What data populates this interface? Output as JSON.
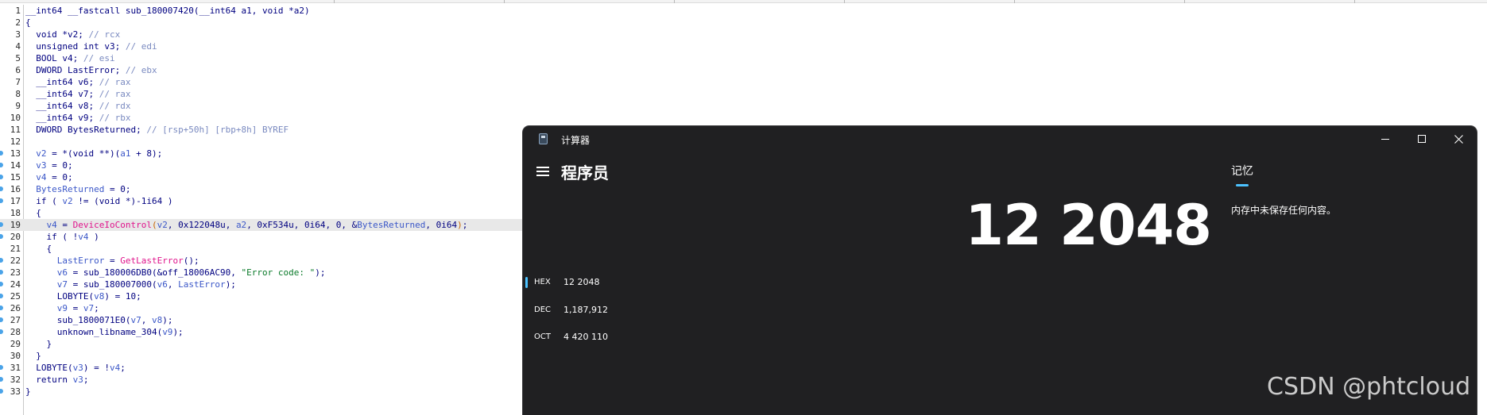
{
  "editor": {
    "lines": [
      {
        "n": "1",
        "code": [
          [
            "n",
            "__int64 __fastcall sub_180007420(__int64 a1, void *a2)"
          ]
        ]
      },
      {
        "n": "2",
        "code": [
          [
            "p",
            "{"
          ]
        ]
      },
      {
        "n": "3",
        "code": [
          [
            "n",
            "  void *v2; "
          ],
          [
            "c",
            "// rcx"
          ]
        ]
      },
      {
        "n": "4",
        "code": [
          [
            "n",
            "  unsigned int v3; "
          ],
          [
            "c",
            "// edi"
          ]
        ]
      },
      {
        "n": "5",
        "code": [
          [
            "n",
            "  BOOL v4; "
          ],
          [
            "c",
            "// esi"
          ]
        ]
      },
      {
        "n": "6",
        "code": [
          [
            "n",
            "  DWORD LastError; "
          ],
          [
            "c",
            "// ebx"
          ]
        ]
      },
      {
        "n": "7",
        "code": [
          [
            "n",
            "  __int64 v6; "
          ],
          [
            "c",
            "// rax"
          ]
        ]
      },
      {
        "n": "8",
        "code": [
          [
            "n",
            "  __int64 v7; "
          ],
          [
            "c",
            "// rax"
          ]
        ]
      },
      {
        "n": "9",
        "code": [
          [
            "n",
            "  __int64 v8; "
          ],
          [
            "c",
            "// rdx"
          ]
        ]
      },
      {
        "n": "10",
        "code": [
          [
            "n",
            "  __int64 v9; "
          ],
          [
            "c",
            "// rbx"
          ]
        ]
      },
      {
        "n": "11",
        "code": [
          [
            "n",
            "  DWORD BytesReturned; "
          ],
          [
            "c",
            "// [rsp+50h] [rbp+8h] BYREF"
          ]
        ]
      },
      {
        "n": "12",
        "code": []
      },
      {
        "n": "13",
        "bp": true,
        "code": [
          [
            "v",
            "  v2"
          ],
          [
            "n",
            " = *(void **)("
          ],
          [
            "v",
            "a1"
          ],
          [
            "n",
            " + 8);"
          ]
        ]
      },
      {
        "n": "14",
        "bp": true,
        "code": [
          [
            "v",
            "  v3"
          ],
          [
            "n",
            " = 0;"
          ]
        ]
      },
      {
        "n": "15",
        "bp": true,
        "code": [
          [
            "v",
            "  v4"
          ],
          [
            "n",
            " = 0;"
          ]
        ]
      },
      {
        "n": "16",
        "bp": true,
        "code": [
          [
            "v",
            "  BytesReturned"
          ],
          [
            "n",
            " = 0;"
          ]
        ]
      },
      {
        "n": "17",
        "bp": true,
        "code": [
          [
            "k",
            "  if"
          ],
          [
            "n",
            " ( "
          ],
          [
            "v",
            "v2"
          ],
          [
            "n",
            " != (void *)-1i64 )"
          ]
        ]
      },
      {
        "n": "18",
        "code": [
          [
            "p",
            "  {"
          ]
        ]
      },
      {
        "n": "19",
        "bp": true,
        "hl": true,
        "code": [
          [
            "v",
            "    v4"
          ],
          [
            "n",
            " = "
          ],
          [
            "f",
            "DeviceIoControl"
          ],
          [
            "o",
            "("
          ],
          [
            "v",
            "v2"
          ],
          [
            "n",
            ", 0x122048u, "
          ],
          [
            "v",
            "a2"
          ],
          [
            "n",
            ", 0xF534u, 0i64, 0, &"
          ],
          [
            "v",
            "BytesReturned"
          ],
          [
            "n",
            ", 0i64"
          ],
          [
            "o",
            ")"
          ],
          [
            "n",
            ";"
          ]
        ]
      },
      {
        "n": "20",
        "bp": true,
        "code": [
          [
            "k",
            "    if"
          ],
          [
            "n",
            " ( !"
          ],
          [
            "v",
            "v4"
          ],
          [
            "n",
            " )"
          ]
        ]
      },
      {
        "n": "21",
        "code": [
          [
            "p",
            "    {"
          ]
        ]
      },
      {
        "n": "22",
        "bp": true,
        "code": [
          [
            "v",
            "      LastError"
          ],
          [
            "n",
            " = "
          ],
          [
            "f",
            "GetLastError"
          ],
          [
            "n",
            "();"
          ]
        ]
      },
      {
        "n": "23",
        "bp": true,
        "code": [
          [
            "v",
            "      v6"
          ],
          [
            "n",
            " = sub_180006DB0(&off_18006AC90, "
          ],
          [
            "s",
            "\"Error code: \""
          ],
          [
            "n",
            ");"
          ]
        ]
      },
      {
        "n": "24",
        "bp": true,
        "code": [
          [
            "v",
            "      v7"
          ],
          [
            "n",
            " = sub_180007000("
          ],
          [
            "v",
            "v6"
          ],
          [
            "n",
            ", "
          ],
          [
            "v",
            "LastError"
          ],
          [
            "n",
            ");"
          ]
        ]
      },
      {
        "n": "25",
        "bp": true,
        "code": [
          [
            "n",
            "      LOBYTE("
          ],
          [
            "v",
            "v8"
          ],
          [
            "n",
            ") = 10;"
          ]
        ]
      },
      {
        "n": "26",
        "bp": true,
        "code": [
          [
            "v",
            "      v9"
          ],
          [
            "n",
            " = "
          ],
          [
            "v",
            "v7"
          ],
          [
            "n",
            ";"
          ]
        ]
      },
      {
        "n": "27",
        "bp": true,
        "code": [
          [
            "n",
            "      sub_1800071E0("
          ],
          [
            "v",
            "v7"
          ],
          [
            "n",
            ", "
          ],
          [
            "v",
            "v8"
          ],
          [
            "n",
            ");"
          ]
        ]
      },
      {
        "n": "28",
        "bp": true,
        "code": [
          [
            "n",
            "      unknown_libname_304("
          ],
          [
            "v",
            "v9"
          ],
          [
            "n",
            ");"
          ]
        ]
      },
      {
        "n": "29",
        "code": [
          [
            "p",
            "    }"
          ]
        ]
      },
      {
        "n": "30",
        "code": [
          [
            "p",
            "  }"
          ]
        ]
      },
      {
        "n": "31",
        "bp": true,
        "code": [
          [
            "n",
            "  LOBYTE("
          ],
          [
            "v",
            "v3"
          ],
          [
            "n",
            ") = !"
          ],
          [
            "v",
            "v4"
          ],
          [
            "n",
            ";"
          ]
        ]
      },
      {
        "n": "32",
        "bp": true,
        "code": [
          [
            "k",
            "  return"
          ],
          [
            "n",
            " "
          ],
          [
            "v",
            "v3"
          ],
          [
            "n",
            ";"
          ]
        ]
      },
      {
        "n": "33",
        "bp": true,
        "code": [
          [
            "p",
            "}"
          ]
        ]
      }
    ]
  },
  "calculator": {
    "window_title": "计算器",
    "mode_title": "程序员",
    "display_value": "12 2048",
    "memory_title": "记忆",
    "memory_empty": "内存中未保存任何内容。",
    "radix": [
      {
        "name": "HEX",
        "value": "12 2048",
        "selected": true
      },
      {
        "name": "DEC",
        "value": "1,187,912",
        "selected": false
      },
      {
        "name": "OCT",
        "value": "4 420 110",
        "selected": false
      }
    ],
    "accent_color": "#4cc2ff",
    "icons": [
      "calculator-app-icon",
      "minimize-icon",
      "maximize-icon",
      "close-icon",
      "hamburger-menu-icon"
    ]
  },
  "watermark": "CSDN @phtcloud"
}
